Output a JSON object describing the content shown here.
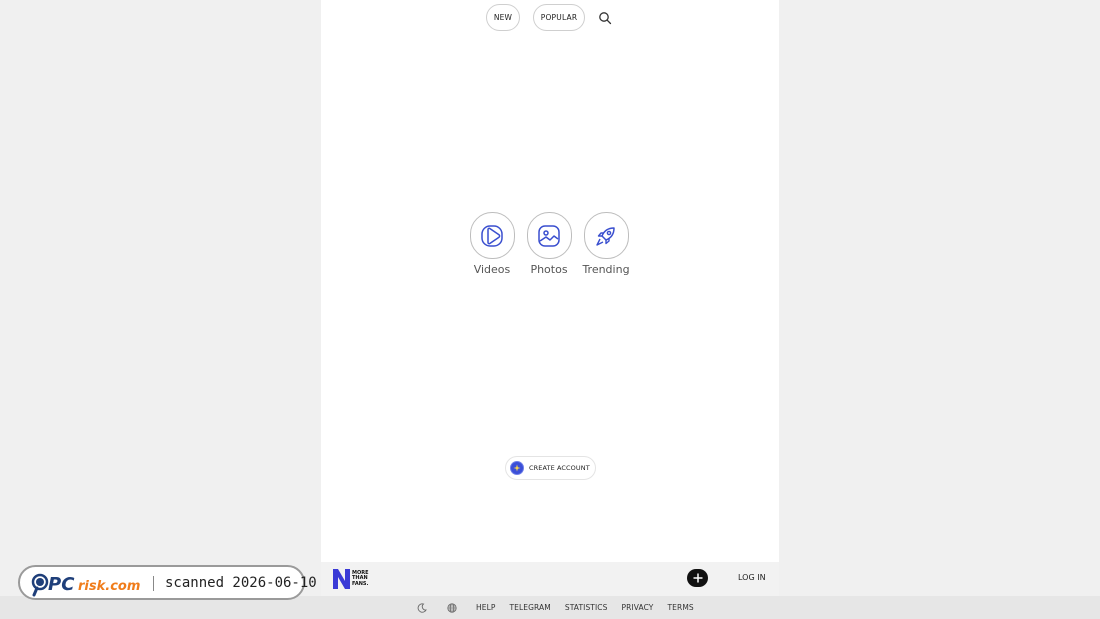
{
  "topnav": {
    "new_label": "NEW",
    "popular_label": "POPULAR",
    "search_icon": "search-icon"
  },
  "categories": [
    {
      "label": "Videos",
      "icon": "play-icon"
    },
    {
      "label": "Photos",
      "icon": "image-icon"
    },
    {
      "label": "Trending",
      "icon": "rocket-icon"
    }
  ],
  "create_account": {
    "label": "CREATE ACCOUNT",
    "icon": "sparkle-icon",
    "color": "#3b4fd8"
  },
  "bottombar": {
    "logo_text": [
      "MORE",
      "THAN",
      "FANS."
    ],
    "logo_letter": "N",
    "logo_color": "#3a3ad6",
    "plus_icon": "plus-icon",
    "login_label": "LOG IN"
  },
  "footer": {
    "theme_icon": "moon-icon",
    "language_icon": "globe-icon",
    "links": [
      "HELP",
      "TELEGRAM",
      "STATISTICS",
      "PRIVACY",
      "TERMS"
    ]
  },
  "badge": {
    "logo_text": "PCrisk.com",
    "scan_text": "scanned 2026-06-10"
  }
}
